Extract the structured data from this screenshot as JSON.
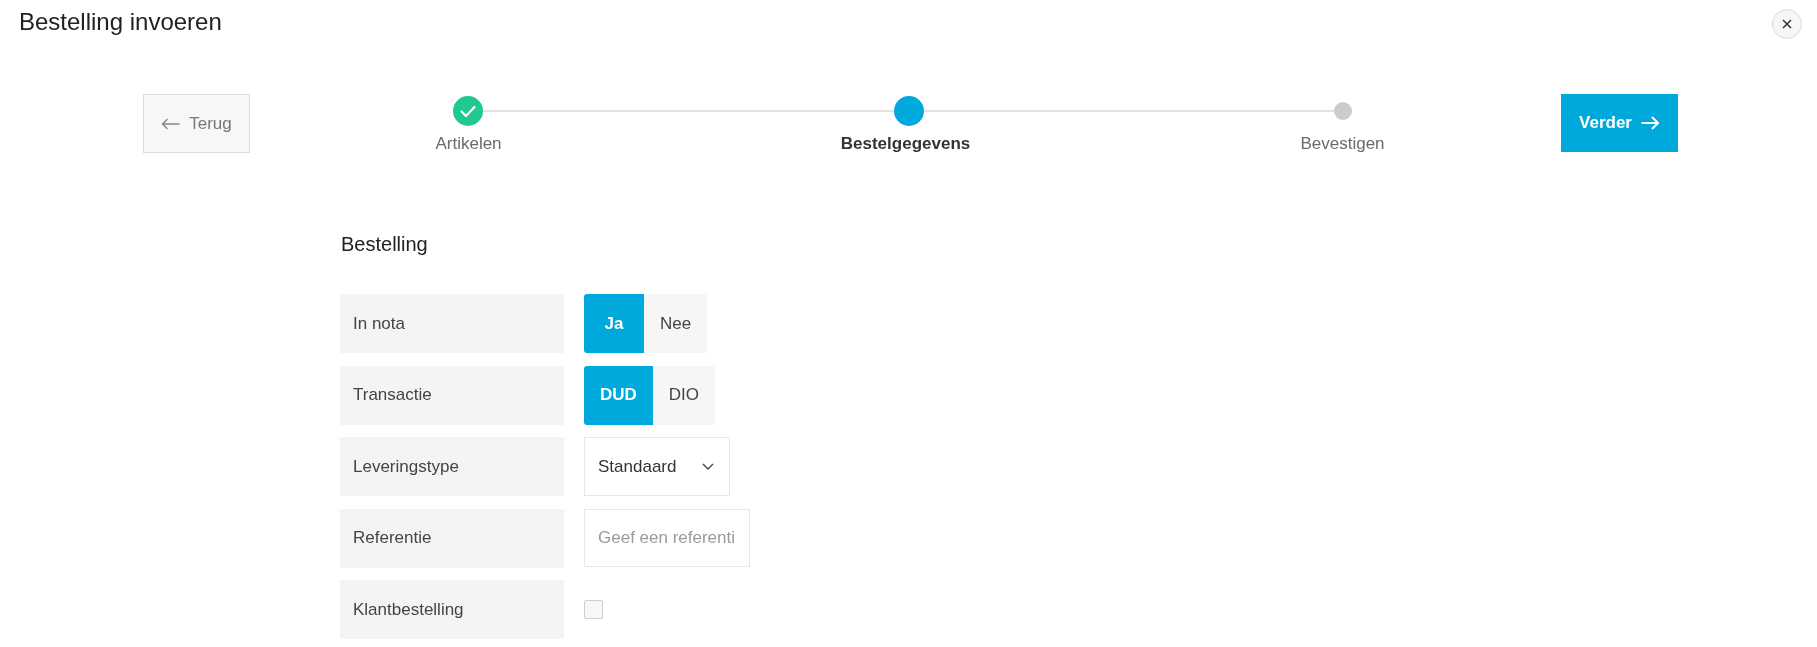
{
  "dialog": {
    "title": "Bestelling invoeren"
  },
  "navigation": {
    "back_button": {
      "label": "Terug"
    },
    "next_button": {
      "label": "Verder"
    }
  },
  "steps": [
    {
      "label": "Artikelen",
      "completed": true,
      "selected": false
    },
    {
      "label": "Bestelgegevens",
      "completed": false,
      "selected": true
    },
    {
      "label": "Bevestigen",
      "completed": false,
      "selected": false
    }
  ],
  "form": {
    "heading": "Bestelling",
    "fields": [
      {
        "label": "In nota",
        "kind": "toggle",
        "options": [
          {
            "label": "Ja",
            "selected": true
          },
          {
            "label": "Nee",
            "selected": false
          }
        ]
      },
      {
        "label": "Transactie",
        "kind": "toggle",
        "options": [
          {
            "label": "DUD",
            "selected": true
          },
          {
            "label": "DIO",
            "selected": false
          }
        ]
      },
      {
        "label": "Leveringstype",
        "kind": "dropdown",
        "value": "Standaard"
      },
      {
        "label": "Referentie",
        "kind": "text",
        "placeholder": "Geef een referenti"
      },
      {
        "label": "Klantbestelling",
        "kind": "checkbox",
        "checked": false
      }
    ]
  }
}
